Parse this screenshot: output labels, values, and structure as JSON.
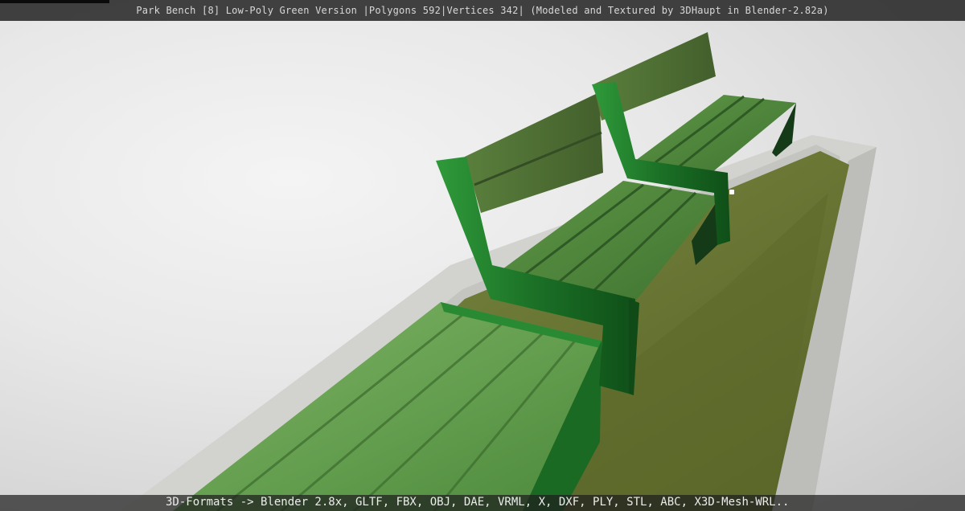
{
  "window": {
    "title": "Park Bench [8] Low-Poly Green Version |Polygons 592|Vertices 342| (Modeled and Textured by 3DHaupt in Blender-2.82a)"
  },
  "footer": {
    "formats": "3D-Formats -> Blender 2.8x, GLTF, FBX, OBJ, DAE, VRML, X, DXF, PLY, STL, ABC, X3D-Mesh-WRL.."
  },
  "colors": {
    "background": "#e6e6e6",
    "bench_metal": "#1f7a2a",
    "bench_wood": "#4e7a3a",
    "grass": "#6f7a3a",
    "planter": "#cfcfcb"
  }
}
